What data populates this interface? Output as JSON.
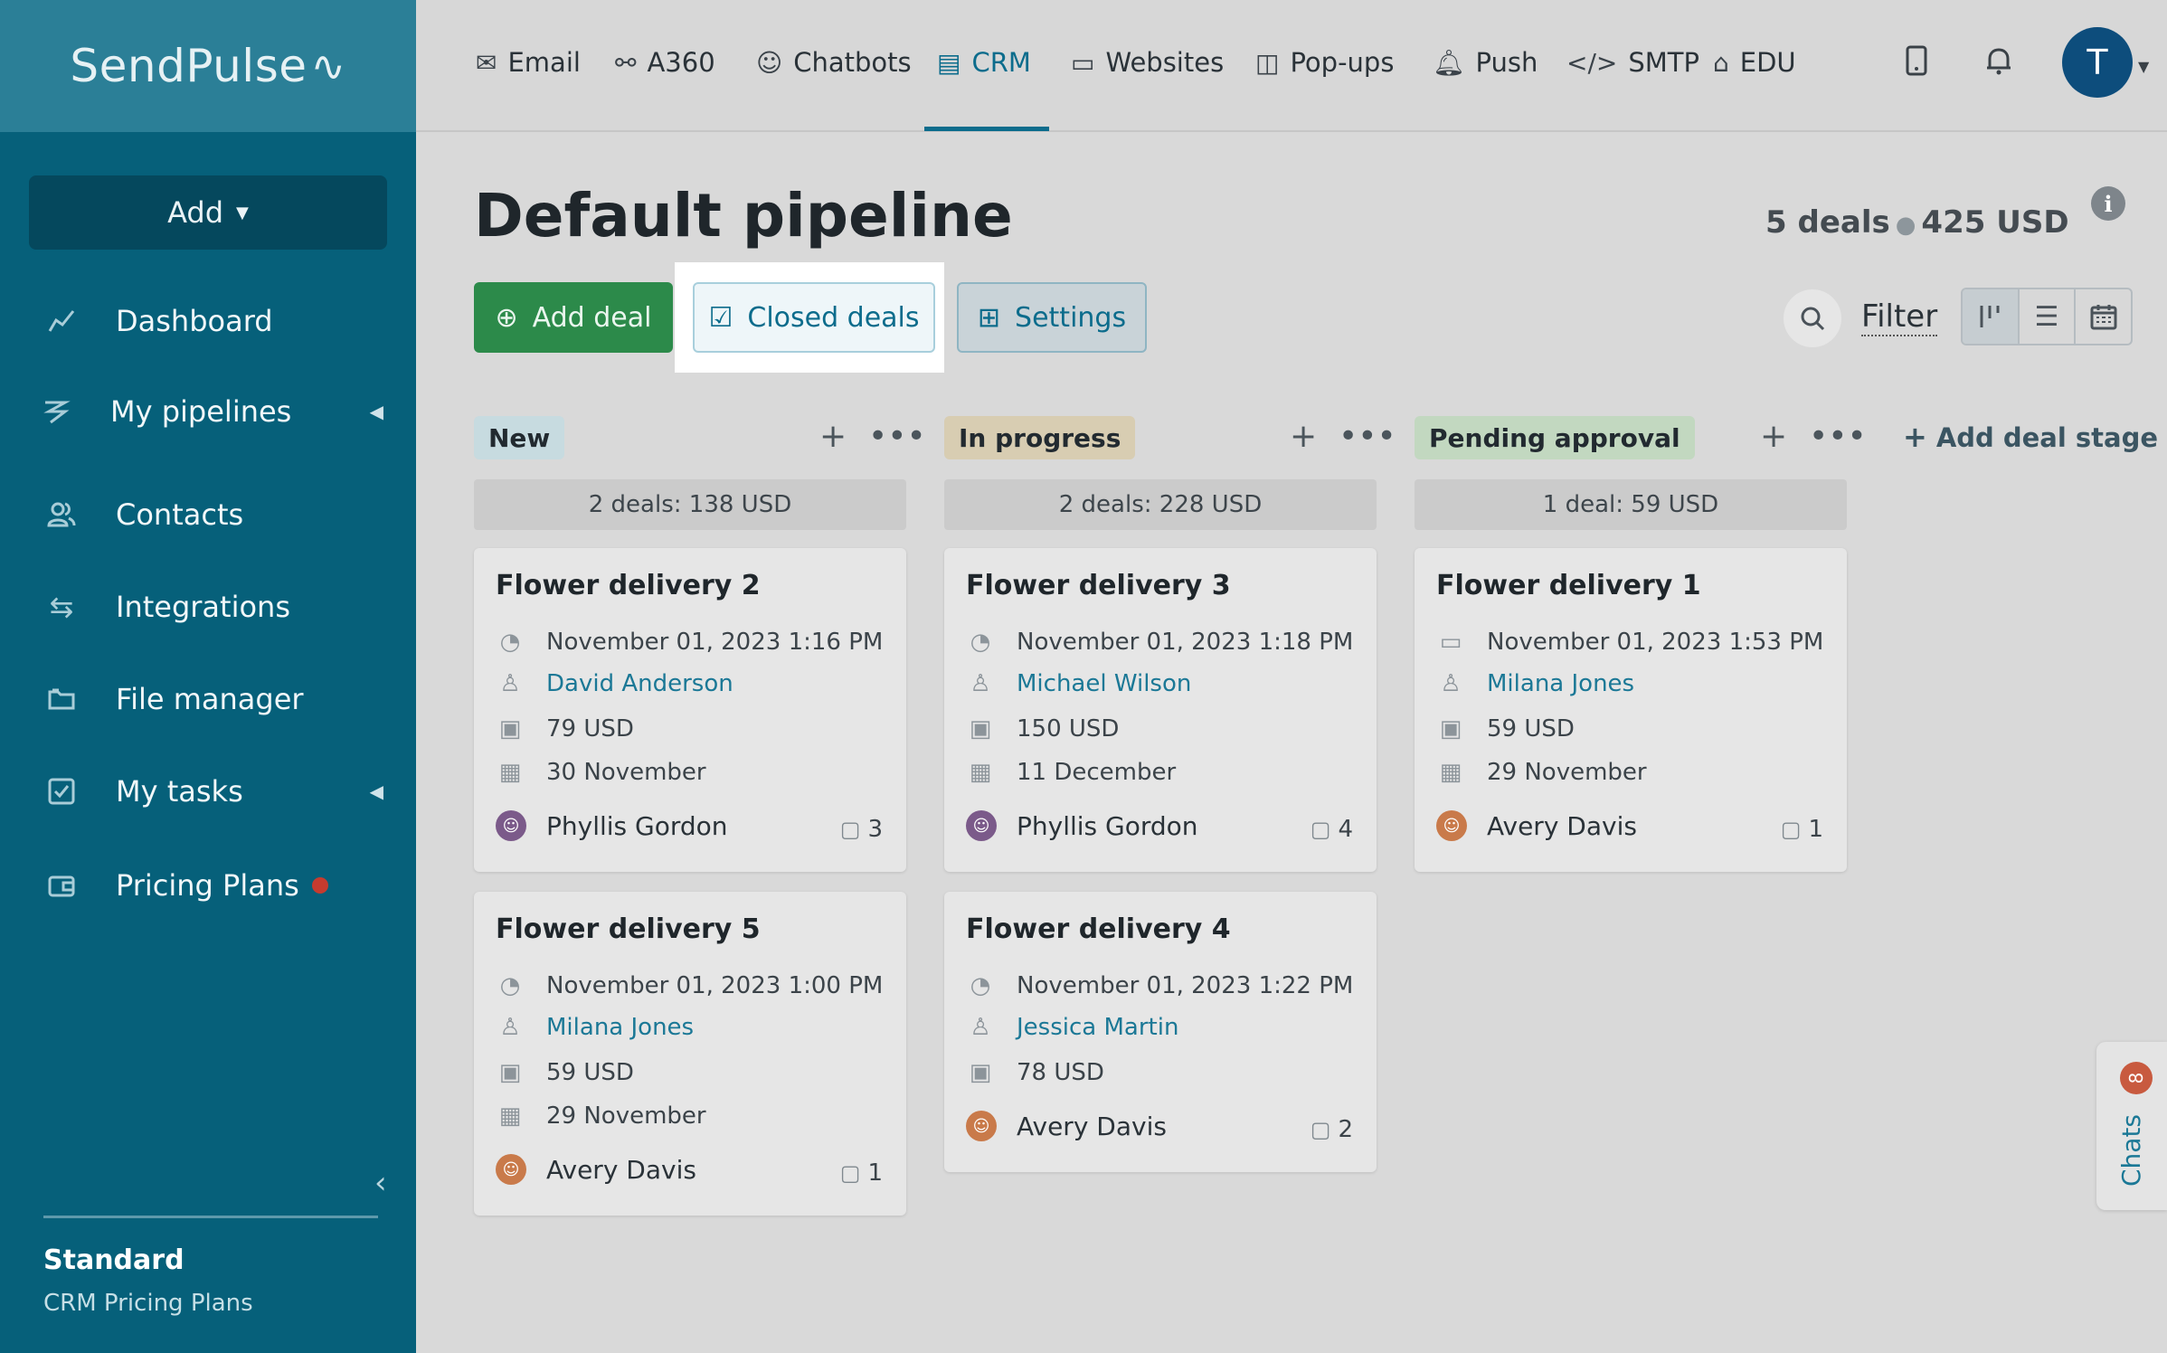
{
  "sidebar": {
    "logo": "SendPulse",
    "add_label": "Add",
    "items": [
      {
        "label": "Dashboard",
        "icon": "chart-line-icon"
      },
      {
        "label": "My pipelines",
        "icon": "pipeline-icon"
      },
      {
        "label": "Contacts",
        "icon": "contacts-icon"
      },
      {
        "label": "Integrations",
        "icon": "arrows-exchange-icon"
      },
      {
        "label": "File manager",
        "icon": "folder-icon"
      },
      {
        "label": "My tasks",
        "icon": "checkbox-icon"
      },
      {
        "label": "Pricing Plans",
        "icon": "wallet-icon"
      }
    ],
    "plan_title": "Standard",
    "plan_sub": "CRM Pricing Plans"
  },
  "topnav": [
    {
      "label": "Email",
      "icon": "envelope-icon"
    },
    {
      "label": "A360",
      "icon": "nodes-icon"
    },
    {
      "label": "Chatbots",
      "icon": "chatbot-icon"
    },
    {
      "label": "CRM",
      "icon": "crm-icon"
    },
    {
      "label": "Websites",
      "icon": "website-icon"
    },
    {
      "label": "Pop-ups",
      "icon": "popup-icon"
    },
    {
      "label": "Push",
      "icon": "bell-icon"
    },
    {
      "label": "SMTP",
      "icon": "code-icon"
    },
    {
      "label": "EDU",
      "icon": "graduation-cap-icon"
    }
  ],
  "user": {
    "initial": "T"
  },
  "page": {
    "title": "Default pipeline",
    "deals_count": "5 deals",
    "deals_total": "425 USD",
    "add_deal": "Add deal",
    "closed_deals": "Closed deals",
    "settings": "Settings",
    "filter": "Filter",
    "add_stage": "Add deal stage"
  },
  "columns": [
    {
      "name": "New",
      "color": "#c7dbe0",
      "summary": "2 deals: 138 USD",
      "cards": [
        {
          "title": "Flower delivery 2",
          "created": "November 01, 2023 1:16 PM",
          "contact": "David Anderson",
          "amount": "79 USD",
          "due": "30 November",
          "owner": "Phyllis Gordon",
          "comments": "3"
        },
        {
          "title": "Flower delivery 5",
          "created": "November 01, 2023 1:00 PM",
          "contact": "Milana Jones",
          "amount": "59 USD",
          "due": "29 November",
          "owner": "Avery Davis",
          "comments": "1"
        }
      ]
    },
    {
      "name": "In progress",
      "color": "#d8cdb2",
      "summary": "2 deals: 228 USD",
      "cards": [
        {
          "title": "Flower delivery 3",
          "created": "November 01, 2023 1:18 PM",
          "contact": "Michael Wilson",
          "amount": "150 USD",
          "due": "11 December",
          "owner": "Phyllis Gordon",
          "comments": "4"
        },
        {
          "title": "Flower delivery 4",
          "created": "November 01, 2023 1:22 PM",
          "contact": "Jessica Martin",
          "amount": "78 USD",
          "due": "",
          "owner": "Avery Davis",
          "comments": "2"
        }
      ]
    },
    {
      "name": "Pending approval",
      "color": "#c2d8c0",
      "summary": "1 deal: 59 USD",
      "cards": [
        {
          "title": "Flower delivery 1",
          "created": "November 01, 2023 1:53 PM",
          "contact": "Milana Jones",
          "amount": "59 USD",
          "due": "29 November",
          "owner": "Avery Davis",
          "comments": "1"
        }
      ]
    }
  ],
  "chats": {
    "label": "Chats",
    "badge": "8"
  }
}
